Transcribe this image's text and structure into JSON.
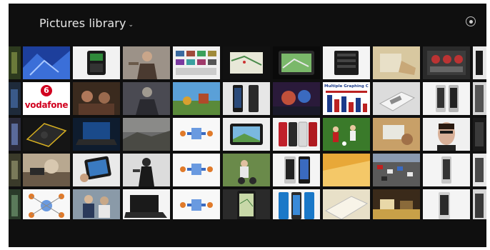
{
  "header": {
    "title": "Pictures library",
    "chevron": "chevron-down-icon",
    "close_icon": "close-circle-icon"
  },
  "tiles": {
    "vodafone_word": "vodafone",
    "vodafone_mark": "6",
    "graphing_title": "Multiple Graphing Calculat"
  },
  "colors": {
    "background": "#0f0f0f",
    "title_text": "#e6e6e6",
    "vodafone_red": "#d1001f"
  }
}
